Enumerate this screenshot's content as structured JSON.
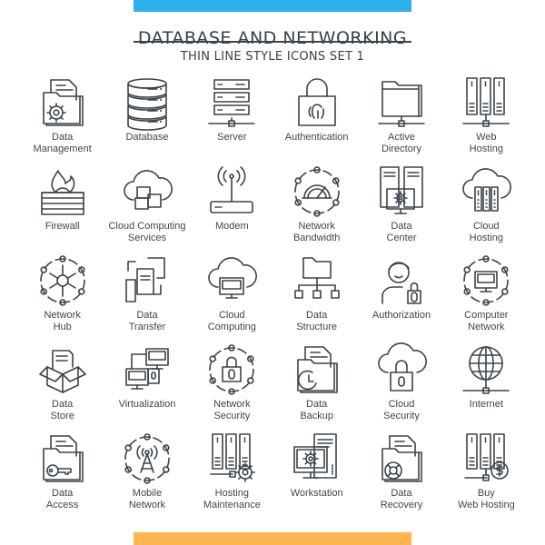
{
  "header": {
    "title": "DATABASE AND NETWORKING",
    "subtitle": "THIN LINE STYLE ICONS SET 1"
  },
  "colors": {
    "top_bar": "#2cb0ec",
    "bottom_bar": "#fdb54f",
    "icon_stroke": "#3b434a"
  },
  "icons": [
    {
      "label": "Data\nManagement",
      "icon": "folder-gear-icon"
    },
    {
      "label": "Database",
      "icon": "database-icon"
    },
    {
      "label": "Server",
      "icon": "server-rack-icon"
    },
    {
      "label": "Authentication",
      "icon": "fingerprint-lock-icon"
    },
    {
      "label": "Active\nDirectory",
      "icon": "network-folder-icon"
    },
    {
      "label": "Web\nHosting",
      "icon": "server-towers-icon"
    },
    {
      "label": "Firewall",
      "icon": "firewall-icon"
    },
    {
      "label": "Cloud Computing\nServices",
      "icon": "cloud-puzzle-icon"
    },
    {
      "label": "Modem",
      "icon": "modem-icon"
    },
    {
      "label": "Network\nBandwidth",
      "icon": "speedometer-network-icon"
    },
    {
      "label": "Data\nCenter",
      "icon": "data-center-icon"
    },
    {
      "label": "Cloud\nHosting",
      "icon": "cloud-servers-icon"
    },
    {
      "label": "Network\nHub",
      "icon": "network-hub-icon"
    },
    {
      "label": "Data\nTransfer",
      "icon": "file-transfer-icon"
    },
    {
      "label": "Cloud\nComputing",
      "icon": "cloud-monitor-icon"
    },
    {
      "label": "Data\nStructure",
      "icon": "folder-tree-icon"
    },
    {
      "label": "Authorization",
      "icon": "user-lock-icon"
    },
    {
      "label": "Computer\nNetwork",
      "icon": "monitor-network-icon"
    },
    {
      "label": "Data\nStore",
      "icon": "open-box-icon"
    },
    {
      "label": "Virtualization",
      "icon": "virtual-monitors-icon"
    },
    {
      "label": "Network\nSecurity",
      "icon": "lock-network-icon"
    },
    {
      "label": "Data\nBackup",
      "icon": "folder-clock-icon"
    },
    {
      "label": "Cloud\nSecurity",
      "icon": "cloud-lock-icon"
    },
    {
      "label": "Internet",
      "icon": "globe-network-icon"
    },
    {
      "label": "Data\nAccess",
      "icon": "folder-key-icon"
    },
    {
      "label": "Mobile\nNetwork",
      "icon": "antenna-network-icon"
    },
    {
      "label": "Hosting\nMaintenance",
      "icon": "server-gear-icon"
    },
    {
      "label": "Workstation",
      "icon": "workstation-icon"
    },
    {
      "label": "Data\nRecovery",
      "icon": "folder-lifebuoy-icon"
    },
    {
      "label": "Buy\nWeb Hosting",
      "icon": "server-dollar-icon"
    }
  ]
}
